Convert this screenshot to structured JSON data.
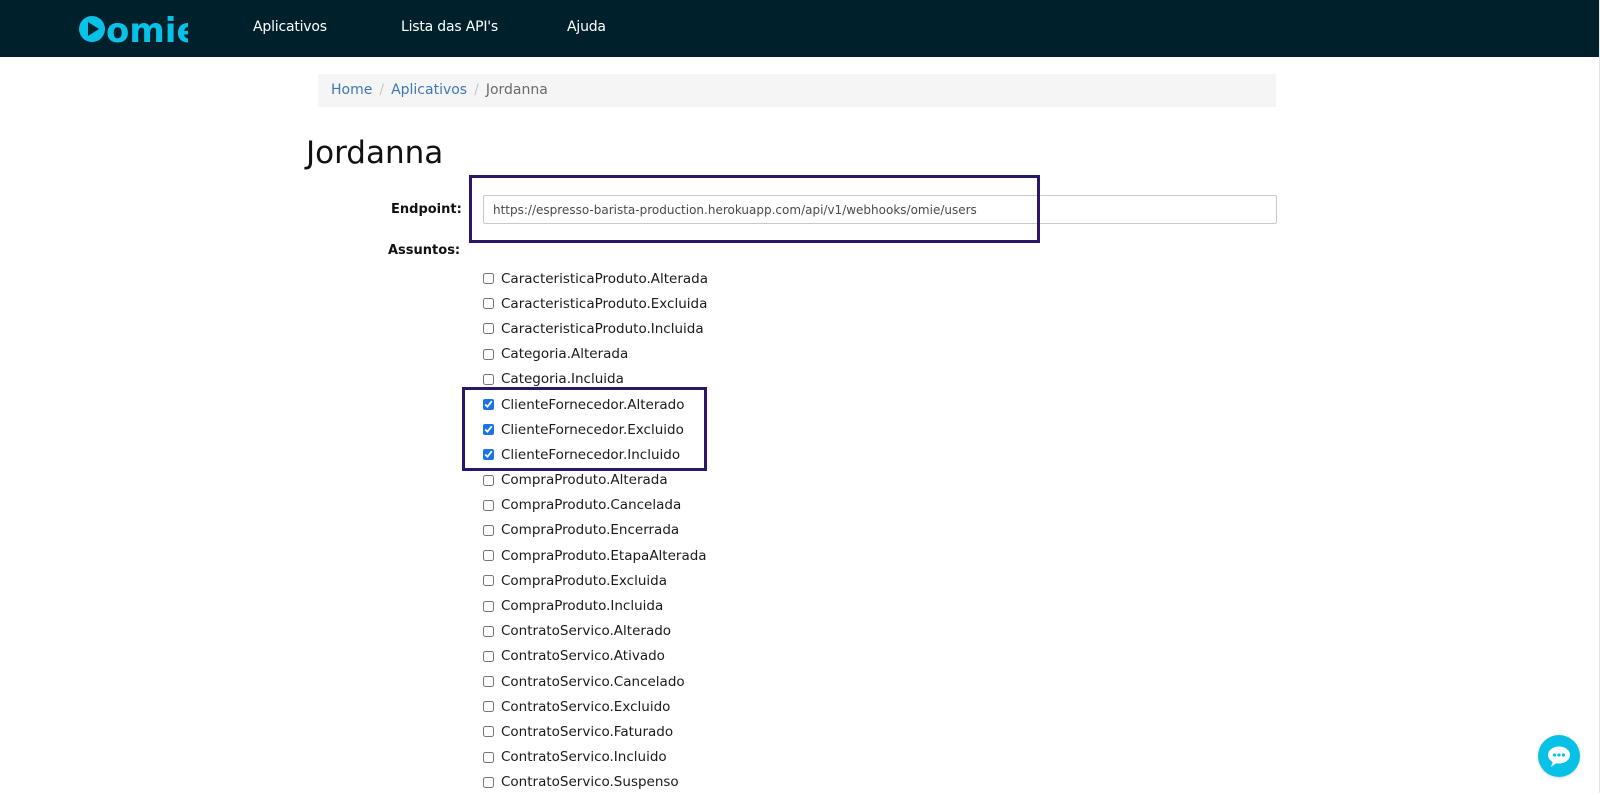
{
  "brand": {
    "logo_text": "omie",
    "accent_color": "#08c1e6",
    "header_bg": "#00212b"
  },
  "nav": {
    "items": [
      {
        "label": "Aplicativos"
      },
      {
        "label": "Lista das API's"
      },
      {
        "label": "Ajuda"
      }
    ]
  },
  "breadcrumb": {
    "home": "Home",
    "apps": "Aplicativos",
    "current": "Jordanna",
    "separator": "/"
  },
  "page": {
    "title": "Jordanna"
  },
  "form": {
    "endpoint_label": "Endpoint:",
    "endpoint_value": "https://espresso-barista-production.herokuapp.com/api/v1/webhooks/omie/users",
    "subjects_label": "Assuntos:"
  },
  "subjects": [
    {
      "label": "CaracteristicaProduto.Alterada",
      "checked": false
    },
    {
      "label": "CaracteristicaProduto.Excluida",
      "checked": false
    },
    {
      "label": "CaracteristicaProduto.Incluida",
      "checked": false
    },
    {
      "label": "Categoria.Alterada",
      "checked": false
    },
    {
      "label": "Categoria.Incluida",
      "checked": false
    },
    {
      "label": "ClienteFornecedor.Alterado",
      "checked": true
    },
    {
      "label": "ClienteFornecedor.Excluido",
      "checked": true
    },
    {
      "label": "ClienteFornecedor.Incluido",
      "checked": true
    },
    {
      "label": "CompraProduto.Alterada",
      "checked": false
    },
    {
      "label": "CompraProduto.Cancelada",
      "checked": false
    },
    {
      "label": "CompraProduto.Encerrada",
      "checked": false
    },
    {
      "label": "CompraProduto.EtapaAlterada",
      "checked": false
    },
    {
      "label": "CompraProduto.Excluida",
      "checked": false
    },
    {
      "label": "CompraProduto.Incluida",
      "checked": false
    },
    {
      "label": "ContratoServico.Alterado",
      "checked": false
    },
    {
      "label": "ContratoServico.Ativado",
      "checked": false
    },
    {
      "label": "ContratoServico.Cancelado",
      "checked": false
    },
    {
      "label": "ContratoServico.Excluido",
      "checked": false
    },
    {
      "label": "ContratoServico.Faturado",
      "checked": false
    },
    {
      "label": "ContratoServico.Incluido",
      "checked": false
    },
    {
      "label": "ContratoServico.Suspenso",
      "checked": false
    }
  ],
  "chat": {
    "icon": "chat-bubble-icon"
  }
}
